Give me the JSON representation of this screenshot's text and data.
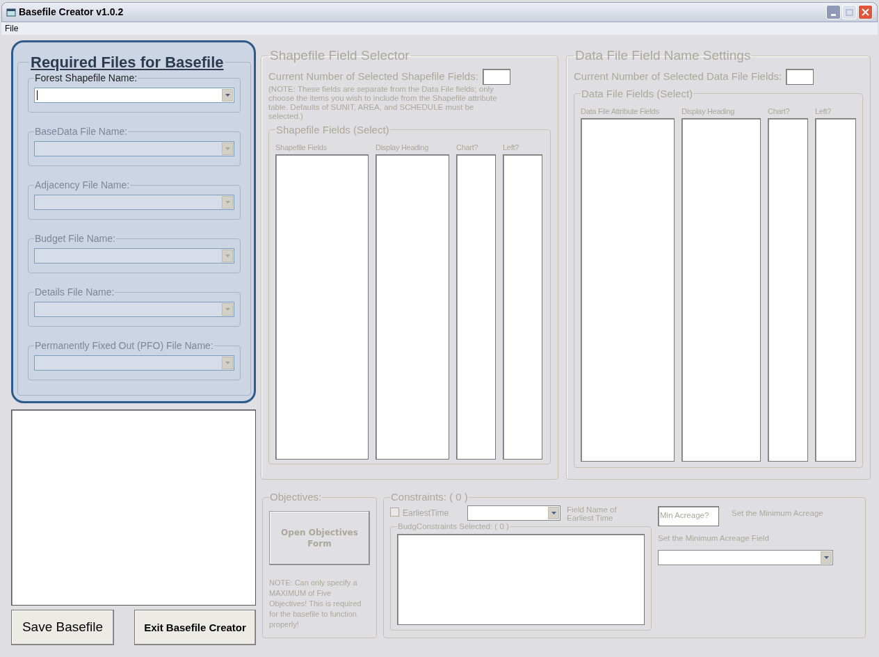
{
  "window": {
    "title": "Basefile Creator v1.0.2"
  },
  "menu": [
    {
      "label": "File"
    }
  ],
  "required_files": {
    "title": "Required Files for Basefile",
    "files": [
      {
        "label": "Forest Shapefile Name:",
        "disabled": false,
        "focused": true
      },
      {
        "label": "BaseData File Name:",
        "disabled": true,
        "focused": false
      },
      {
        "label": "Adjacency File Name:",
        "disabled": true,
        "focused": false
      },
      {
        "label": "Budget File Name:",
        "disabled": true,
        "focused": false
      },
      {
        "label": "Details File Name:",
        "disabled": true,
        "focused": false
      },
      {
        "label": "Permanently Fixed Out (PFO) File Name:",
        "disabled": true,
        "focused": false
      }
    ]
  },
  "buttons": [
    {
      "label": "Save Basefile",
      "kind": "plain"
    },
    {
      "label": "Exit Basefile Creator",
      "kind": "bold"
    }
  ],
  "shapefile_selector": {
    "title": "Shapefile Field Selector",
    "disabled": true,
    "count_label": "Current Number of Selected Shapefile Fields:",
    "note": "(NOTE: These fields are separate from the Data File fields; only choose the items you wish to include from the Shapefile attribute table. Defaults of SUNIT, AREA, and SCHEDULE must be selected.)",
    "fields_title": "Shapefile Fields (Select)",
    "columns": [
      "Shapefile Fields",
      "Display Heading",
      "Chart?",
      "Left?"
    ]
  },
  "data_file_settings": {
    "title": "Data File Field Name Settings",
    "disabled": true,
    "count_label": "Current Number of Selected Data File Fields:",
    "fields_title": "Data File Fields (Select)",
    "columns": [
      "Data File Attribute Fields",
      "Display Heading",
      "Chart?",
      "Left?"
    ]
  },
  "objectives": {
    "title": "Objectives:",
    "disabled": true,
    "button": "Open Objectives Form",
    "note": "NOTE: Can only specify a MAXIMUM of Five Objectives! This is required for the basefile to function properly!"
  },
  "constraints": {
    "title": "Constraints: ( 0 )",
    "disabled": true,
    "earliest_time": {
      "label": "EarliestTime",
      "checked": false
    },
    "earliest_time_field_label": "Field Name of Earliest Time",
    "budg_title": "BudgConstraints Selected: ( 0 )",
    "min_acreage": {
      "value": "Min Acreage?"
    },
    "min_acreage_label": "Set the Minimum Acreage",
    "min_acreage_field_label": "Set the Minimum Acreage Field"
  }
}
